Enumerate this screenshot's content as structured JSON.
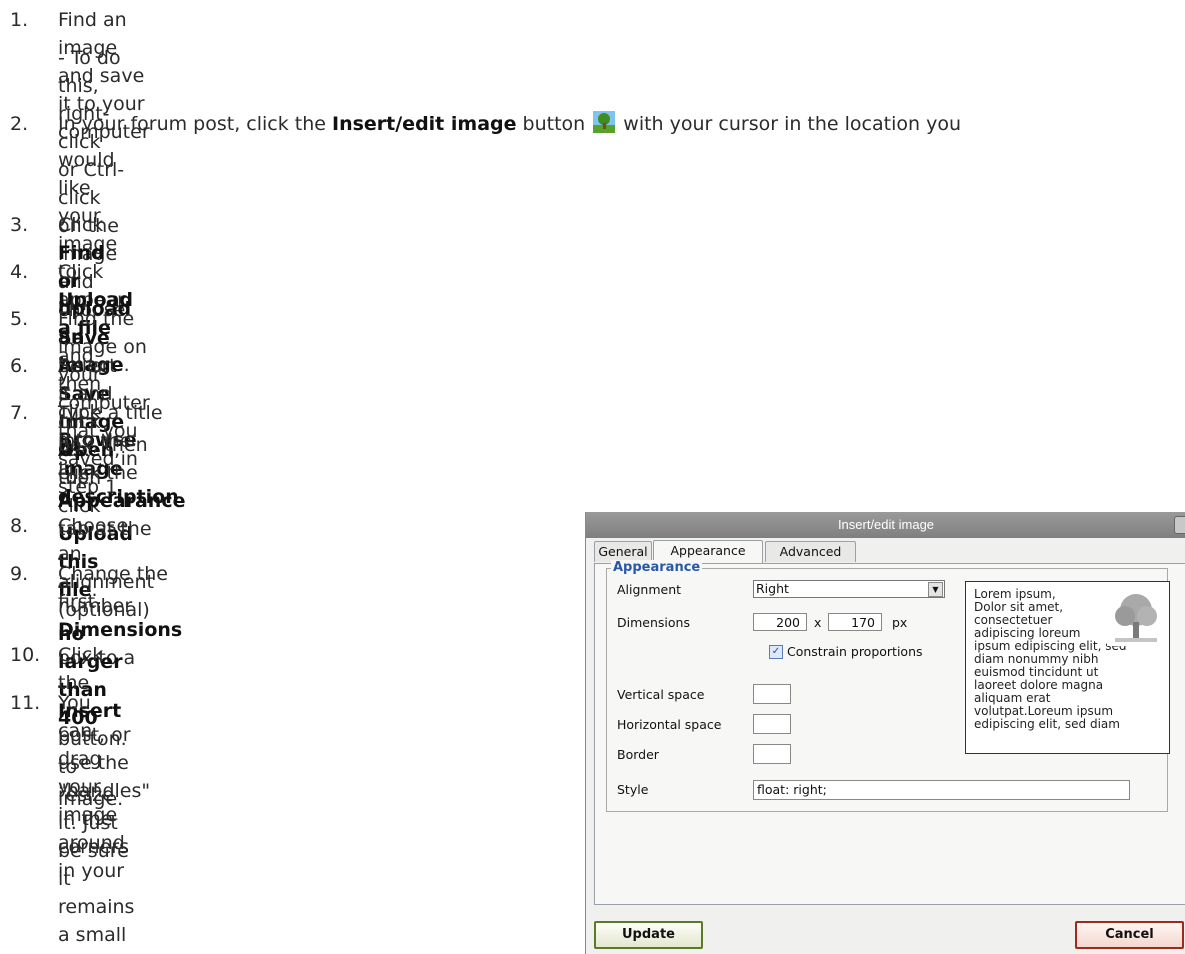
{
  "steps": [
    {
      "num": "1.",
      "a": "Find an image and save it to your computer"
    },
    {
      "sub_a": "- To do this, right-click or Ctrl-click on the image and choose ",
      "sub_b": "Save As",
      "sub_c": " or ",
      "sub_d": "Save Image As",
      "sub_e": "."
    },
    {
      "num": "2.",
      "a": "In your forum post, click the ",
      "b": "Insert/edit image",
      "c": " button ",
      "d": " with your cursor in the location you",
      "e": "would like your image to appear."
    },
    {
      "num": "3.",
      "a": "Click ",
      "b": "Find or upload an image",
      "c": "."
    },
    {
      "num": "4.",
      "a": "Click ",
      "b": "Upload a file",
      "c": " and then click ",
      "d": "Browse"
    },
    {
      "num": "5.",
      "a": "Find the image on your computer that you saved in step 1."
    },
    {
      "num": "6.",
      "a": "Select it and click ",
      "b": "Open",
      "c": ", then click ",
      "d": "Upload this file",
      "e": "."
    },
    {
      "num": "7.",
      "a": "Type a title into the I",
      "b": "mage description",
      "c": "box, then click the ",
      "d": "Appearance",
      "e": " tab at the",
      "f": "top."
    },
    {
      "num": "8.",
      "a": "Choose an alignment (optional)"
    },
    {
      "num": "9.",
      "a": "Change the first ",
      "b": "Dimensions",
      "c": " box to a",
      "d": "number ",
      "e": "no larger than 400"
    },
    {
      "num": "10.",
      "a": "Click the ",
      "b": "Insert",
      "c": " button."
    },
    {
      "num": "11.",
      "a": "You can drag your image around in your",
      "b": "post, or use the \"handles\" in the corners",
      "c": "to resize it. Just be sure it remains a small",
      "d": "image."
    }
  ],
  "dialog": {
    "title": "Insert/edit image",
    "tabs": [
      "General",
      "Appearance",
      "Advanced"
    ],
    "legend": "Appearance",
    "labels": {
      "alignment": "Alignment",
      "dimensions": "Dimensions",
      "vertical_space": "Vertical space",
      "horizontal_space": "Horizontal space",
      "border": "Border",
      "style": "Style",
      "constrain": "Constrain proportions",
      "x": "x",
      "px": "px"
    },
    "alignment_value": "Right",
    "width_value": "200",
    "height_value": "170",
    "constrain_checked": true,
    "style_value": "float: right;",
    "preview_text": "Lorem ipsum,\nDolor sit amet,\nconsectetuer\nadipiscing loreum\nipsum edipiscing elit, sed\ndiam nonummy nibh\neuismod tincidunt ut\nlaoreet dolore magna\naliquam erat\nvolutpat.Loreum ipsum\nedipiscing elit, sed diam",
    "update_label": "Update",
    "cancel_label": "Cancel"
  },
  "icons": {
    "insert_image": "tree-picture-icon",
    "close": "close-icon",
    "dropdown": "chevron-down-icon"
  }
}
